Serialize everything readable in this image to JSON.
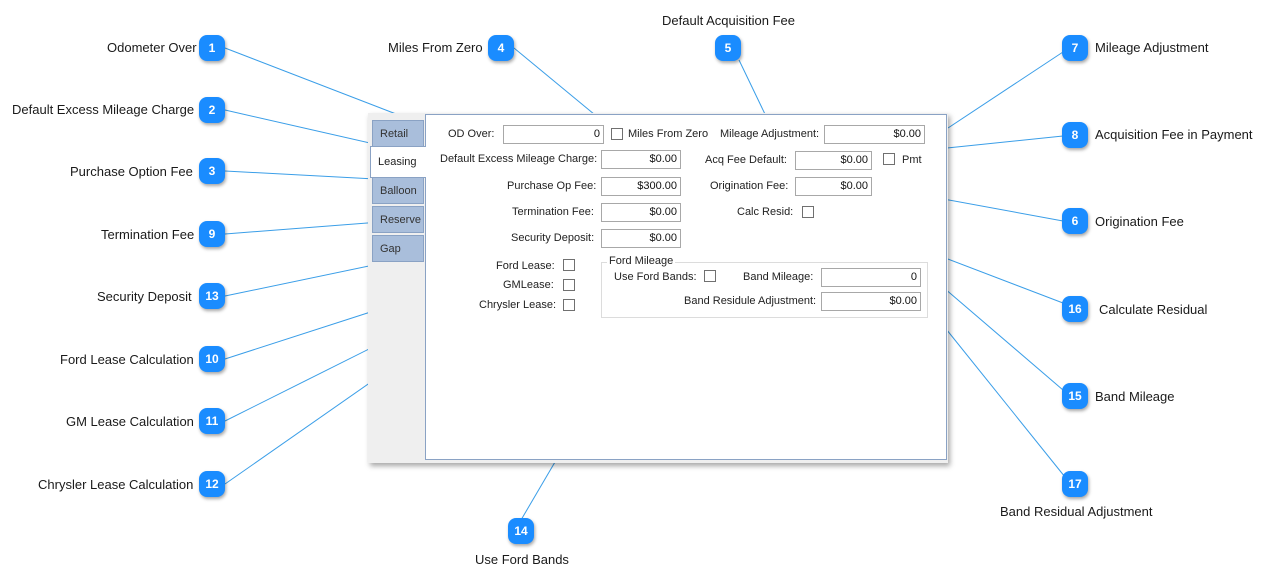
{
  "tabs": [
    "Retail",
    "Leasing",
    "Balloon",
    "Reserve",
    "Gap"
  ],
  "form": {
    "od_over_label": "OD Over:",
    "od_over_value": "0",
    "miles_from_zero_label": "Miles From Zero",
    "mileage_adjustment_label": "Mileage Adjustment:",
    "mileage_adjustment_value": "$0.00",
    "default_excess_label": "Default Excess Mileage Charge:",
    "default_excess_value": "$0.00",
    "acq_fee_default_label": "Acq Fee Default:",
    "acq_fee_default_value": "$0.00",
    "pmt_label": "Pmt",
    "purchase_op_label": "Purchase Op Fee:",
    "purchase_op_value": "$300.00",
    "origination_fee_label": "Origination Fee:",
    "origination_fee_value": "$0.00",
    "termination_fee_label": "Termination Fee:",
    "termination_fee_value": "$0.00",
    "calc_resid_label": "Calc Resid:",
    "security_deposit_label": "Security Deposit:",
    "security_deposit_value": "$0.00",
    "ford_lease_label": "Ford Lease:",
    "gm_lease_label": "GMLease:",
    "chrysler_lease_label": "Chrysler Lease:",
    "ford_mileage_title": "Ford Mileage",
    "use_ford_bands_label": "Use Ford Bands:",
    "band_mileage_label": "Band Mileage:",
    "band_mileage_value": "0",
    "band_residule_label": "Band Residule Adjustment:",
    "band_residule_value": "$0.00"
  },
  "callouts": [
    {
      "num": "1",
      "label": "Odometer Over"
    },
    {
      "num": "2",
      "label": "Default Excess Mileage Charge"
    },
    {
      "num": "3",
      "label": "Purchase Option Fee"
    },
    {
      "num": "9",
      "label": "Termination Fee"
    },
    {
      "num": "13",
      "label": "Security Deposit"
    },
    {
      "num": "10",
      "label": "Ford Lease Calculation"
    },
    {
      "num": "11",
      "label": "GM Lease Calculation"
    },
    {
      "num": "12",
      "label": "Chrysler Lease Calculation"
    },
    {
      "num": "4",
      "label": "Miles From Zero"
    },
    {
      "num": "5",
      "label": "Default Acquisition Fee"
    },
    {
      "num": "14",
      "label": "Use Ford Bands"
    },
    {
      "num": "7",
      "label": "Mileage Adjustment"
    },
    {
      "num": "8",
      "label": "Acquisition Fee in Payment"
    },
    {
      "num": "6",
      "label": "Origination Fee"
    },
    {
      "num": "16",
      "label": "Calculate Residual"
    },
    {
      "num": "15",
      "label": "Band Mileage"
    },
    {
      "num": "17",
      "label": "Band Residual Adjustment"
    }
  ],
  "colors": {
    "badge": "#1a8cff",
    "leader_line": "#3a9ee8",
    "tab_inactive": "#a9bedb",
    "panel_border": "#8aa2c4"
  }
}
